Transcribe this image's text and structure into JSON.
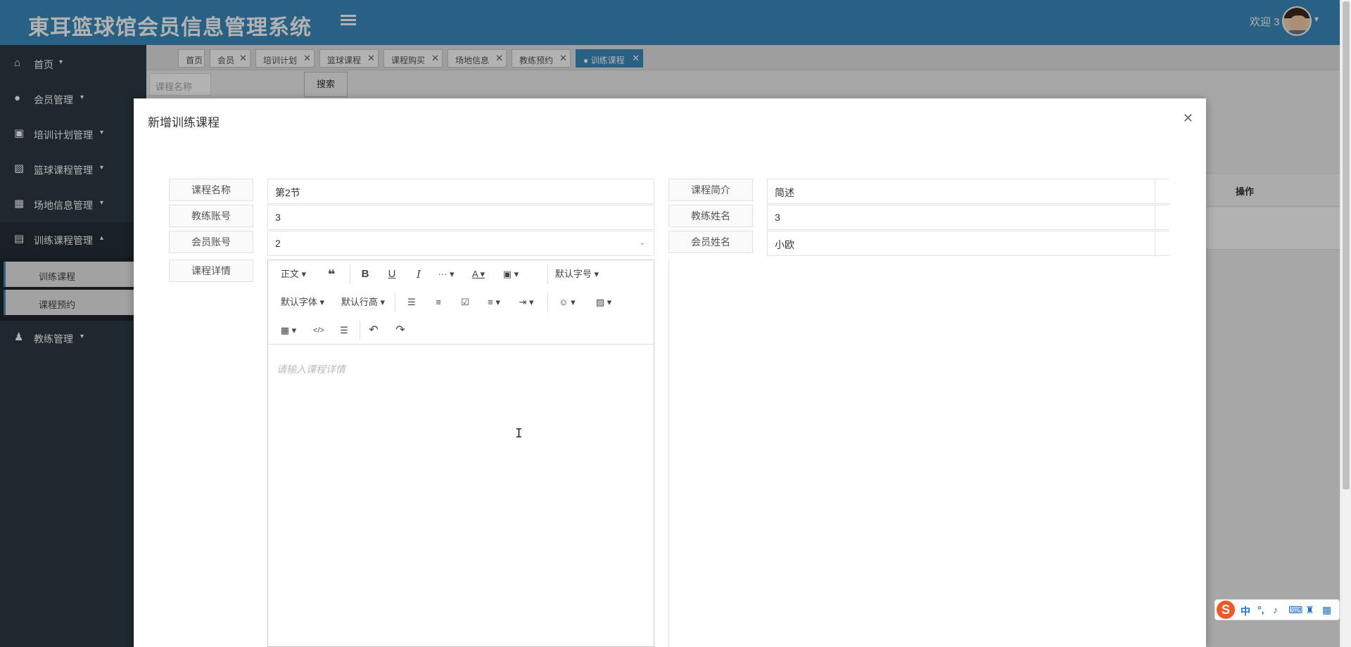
{
  "app": {
    "title": "東耳篮球馆会员信息管理系统",
    "welcome": "欢迎 3"
  },
  "sidebar": {
    "items": [
      {
        "label": "首页",
        "icon": "home-icon"
      },
      {
        "label": "会员管理",
        "icon": "member-icon"
      },
      {
        "label": "培训计划管理",
        "icon": "plan-icon"
      },
      {
        "label": "篮球课程管理",
        "icon": "course-icon"
      },
      {
        "label": "场地信息管理",
        "icon": "venue-icon"
      },
      {
        "label": "训练课程管理",
        "icon": "training-icon"
      },
      {
        "label": "教练管理",
        "icon": "coach-icon"
      }
    ],
    "sub_items": [
      {
        "label": "训练课程"
      },
      {
        "label": "课程预约"
      }
    ]
  },
  "tabs": [
    {
      "label": "首页",
      "closable": false
    },
    {
      "label": "会员",
      "closable": true
    },
    {
      "label": "培训计划",
      "closable": true
    },
    {
      "label": "篮球课程",
      "closable": true
    },
    {
      "label": "课程购买",
      "closable": true
    },
    {
      "label": "场地信息",
      "closable": true
    },
    {
      "label": "教练预约",
      "closable": true
    },
    {
      "label": "● 训练课程",
      "closable": true,
      "active": true
    }
  ],
  "search": {
    "placeholder": "课程名称",
    "button_label": "搜索"
  },
  "table": {
    "ops_header": "操作"
  },
  "modal": {
    "title": "新增训练课程",
    "fields": {
      "course_name": {
        "label": "课程名称",
        "value": "第2节"
      },
      "course_intro": {
        "label": "课程简介",
        "value": "简述"
      },
      "coach_account": {
        "label": "教练账号",
        "value": "3"
      },
      "coach_name": {
        "label": "教练姓名",
        "value": "3"
      },
      "member_account": {
        "label": "会员账号",
        "value": "2"
      },
      "member_name": {
        "label": "会员姓名",
        "value": "小欧"
      },
      "course_detail": {
        "label": "课程详情",
        "placeholder": "请输入课程详情"
      }
    }
  },
  "editor": {
    "toolbar": {
      "paragraph": "正文",
      "font_size": "默认字号",
      "font_family": "默认字体",
      "line_height": "默认行高"
    }
  },
  "ime": {
    "mode": "中"
  },
  "colors": {
    "header": "#3a8bbd",
    "sidebar": "#2b3a42",
    "active_tab": "#3a8bbd"
  }
}
